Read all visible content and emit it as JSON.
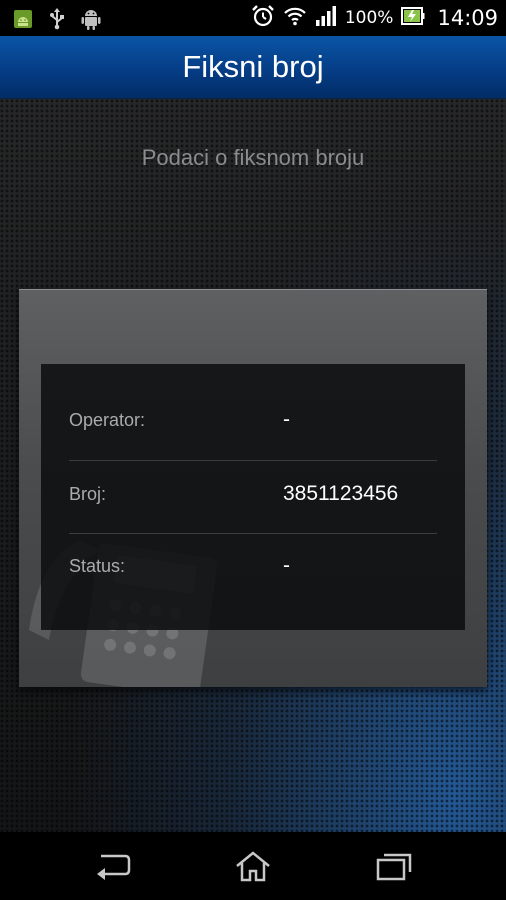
{
  "status_bar": {
    "left_icons": [
      "android-debug-icon",
      "usb-icon",
      "android-icon"
    ],
    "right_icons": [
      "alarm-icon",
      "wifi-icon",
      "signal-icon",
      "battery-icon"
    ],
    "battery": "100%",
    "time": "14:09"
  },
  "action_bar": {
    "title": "Fiksni broj"
  },
  "main": {
    "subtitle": "Podaci o fiksnom broju",
    "rows": [
      {
        "label": "Operator:",
        "value": "-"
      },
      {
        "label": "Broj:",
        "value": "3851123456"
      },
      {
        "label": "Status:",
        "value": "-"
      }
    ]
  },
  "nav_bar": {
    "icons": [
      "back-icon",
      "home-icon",
      "recent-apps-icon"
    ]
  },
  "colors": {
    "action_bar": "#064392",
    "background": "#1e1f20",
    "accent_glow": "#286ebe"
  }
}
